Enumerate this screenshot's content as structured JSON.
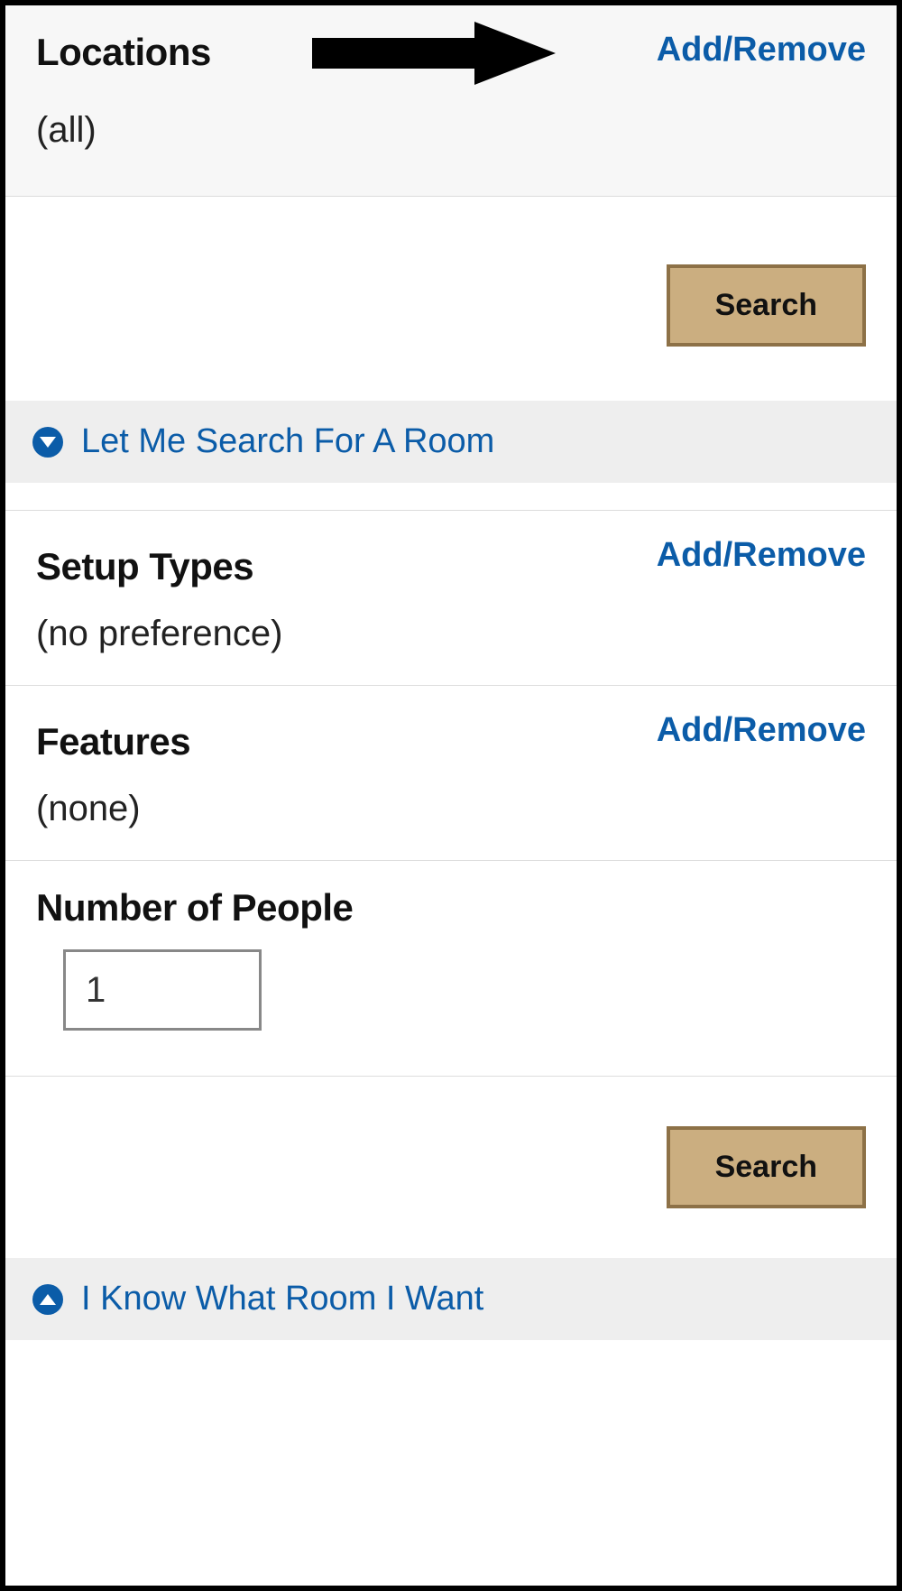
{
  "locations": {
    "heading": "Locations",
    "value": "(all)",
    "add_remove": "Add/Remove"
  },
  "buttons": {
    "search": "Search"
  },
  "collapse1": {
    "title": "Let Me Search For A Room"
  },
  "setup_types": {
    "heading": "Setup Types",
    "value": "(no preference)",
    "add_remove": "Add/Remove"
  },
  "features": {
    "heading": "Features",
    "value": "(none)",
    "add_remove": "Add/Remove"
  },
  "people": {
    "heading": "Number of People",
    "value": "1"
  },
  "collapse2": {
    "title": "I Know What Room I Want"
  }
}
